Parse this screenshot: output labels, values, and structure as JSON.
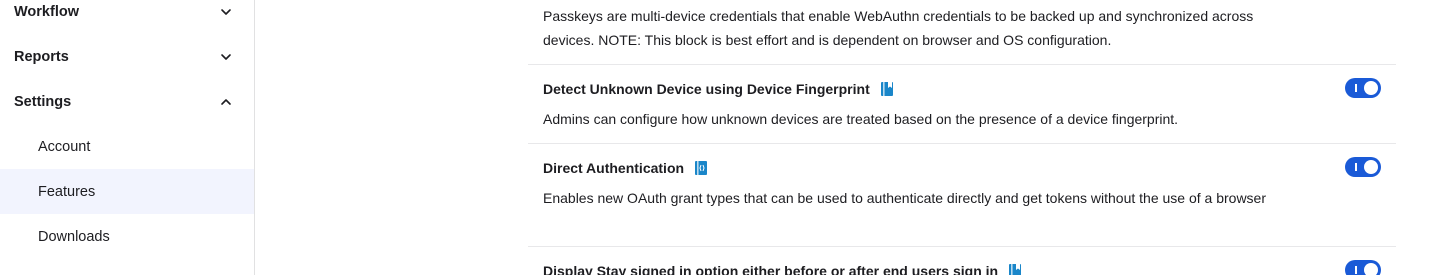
{
  "sidebar": {
    "groups": [
      {
        "label": "Workflow",
        "expanded": false
      },
      {
        "label": "Reports",
        "expanded": false
      },
      {
        "label": "Settings",
        "expanded": true
      }
    ],
    "settings_items": [
      {
        "label": "Account",
        "active": false
      },
      {
        "label": "Features",
        "active": true
      },
      {
        "label": "Downloads",
        "active": false
      }
    ]
  },
  "features": {
    "passkeys_desc": "Passkeys are multi-device credentials that enable WebAuthn credentials to be backed up and synchronized across devices. NOTE: This block is best effort and is dependent on browser and OS configuration.",
    "items": [
      {
        "title": "Detect Unknown Device using Device Fingerprint",
        "desc": "Admins can configure how unknown devices are treated based on the presence of a device fingerprint.",
        "icon": "book-icon",
        "enabled": true
      },
      {
        "title": "Direct Authentication",
        "desc": "Enables new OAuth grant types that can be used to authenticate directly and get tokens without the use of a browser",
        "icon": "book-icon",
        "enabled": true
      },
      {
        "title": "Display Stay signed in option either before or after end users sign in",
        "desc": "",
        "icon": "book-icon",
        "enabled": true
      }
    ]
  },
  "colors": {
    "accent": "#1a5ad7",
    "active_nav_bg": "#f2f4fe",
    "doc_icon": "#1a86c9"
  }
}
